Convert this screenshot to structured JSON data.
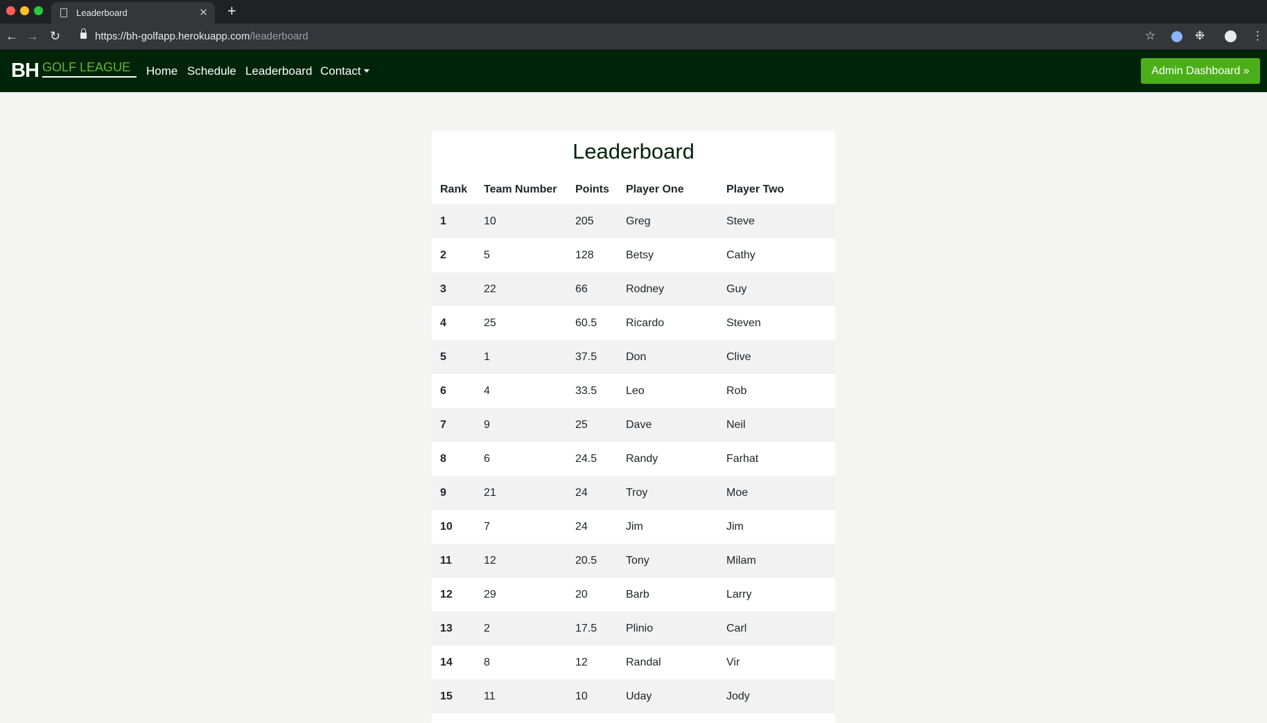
{
  "browser": {
    "tab_title": "Leaderboard",
    "url_host": "https://bh-golfapp.herokuapp.com",
    "url_path": "/leaderboard"
  },
  "nav": {
    "brand_bh": "BH",
    "brand_sub": "GOLF LEAGUE",
    "links": [
      "Home",
      "Schedule",
      "Leaderboard",
      "Contact"
    ],
    "admin_button": "Admin Dashboard »"
  },
  "page": {
    "title": "Leaderboard",
    "headers": [
      "Rank",
      "Team Number",
      "Points",
      "Player One",
      "Player Two"
    ],
    "rows": [
      {
        "rank": "1",
        "team": "10",
        "points": "205",
        "p1": "Greg",
        "p2": "Steve"
      },
      {
        "rank": "2",
        "team": "5",
        "points": "128",
        "p1": "Betsy",
        "p2": "Cathy"
      },
      {
        "rank": "3",
        "team": "22",
        "points": "66",
        "p1": "Rodney",
        "p2": "Guy"
      },
      {
        "rank": "4",
        "team": "25",
        "points": "60.5",
        "p1": "Ricardo",
        "p2": "Steven"
      },
      {
        "rank": "5",
        "team": "1",
        "points": "37.5",
        "p1": "Don",
        "p2": "Clive"
      },
      {
        "rank": "6",
        "team": "4",
        "points": "33.5",
        "p1": "Leo",
        "p2": "Rob"
      },
      {
        "rank": "7",
        "team": "9",
        "points": "25",
        "p1": "Dave",
        "p2": "Neil"
      },
      {
        "rank": "8",
        "team": "6",
        "points": "24.5",
        "p1": "Randy",
        "p2": "Farhat"
      },
      {
        "rank": "9",
        "team": "21",
        "points": "24",
        "p1": "Troy",
        "p2": "Moe"
      },
      {
        "rank": "10",
        "team": "7",
        "points": "24",
        "p1": "Jim",
        "p2": "Jim"
      },
      {
        "rank": "11",
        "team": "12",
        "points": "20.5",
        "p1": "Tony",
        "p2": "Milam"
      },
      {
        "rank": "12",
        "team": "29",
        "points": "20",
        "p1": "Barb",
        "p2": "Larry"
      },
      {
        "rank": "13",
        "team": "2",
        "points": "17.5",
        "p1": "Plinio",
        "p2": "Carl"
      },
      {
        "rank": "14",
        "team": "8",
        "points": "12",
        "p1": "Randal",
        "p2": "Vir"
      },
      {
        "rank": "15",
        "team": "11",
        "points": "10",
        "p1": "Uday",
        "p2": "Jody"
      }
    ]
  }
}
